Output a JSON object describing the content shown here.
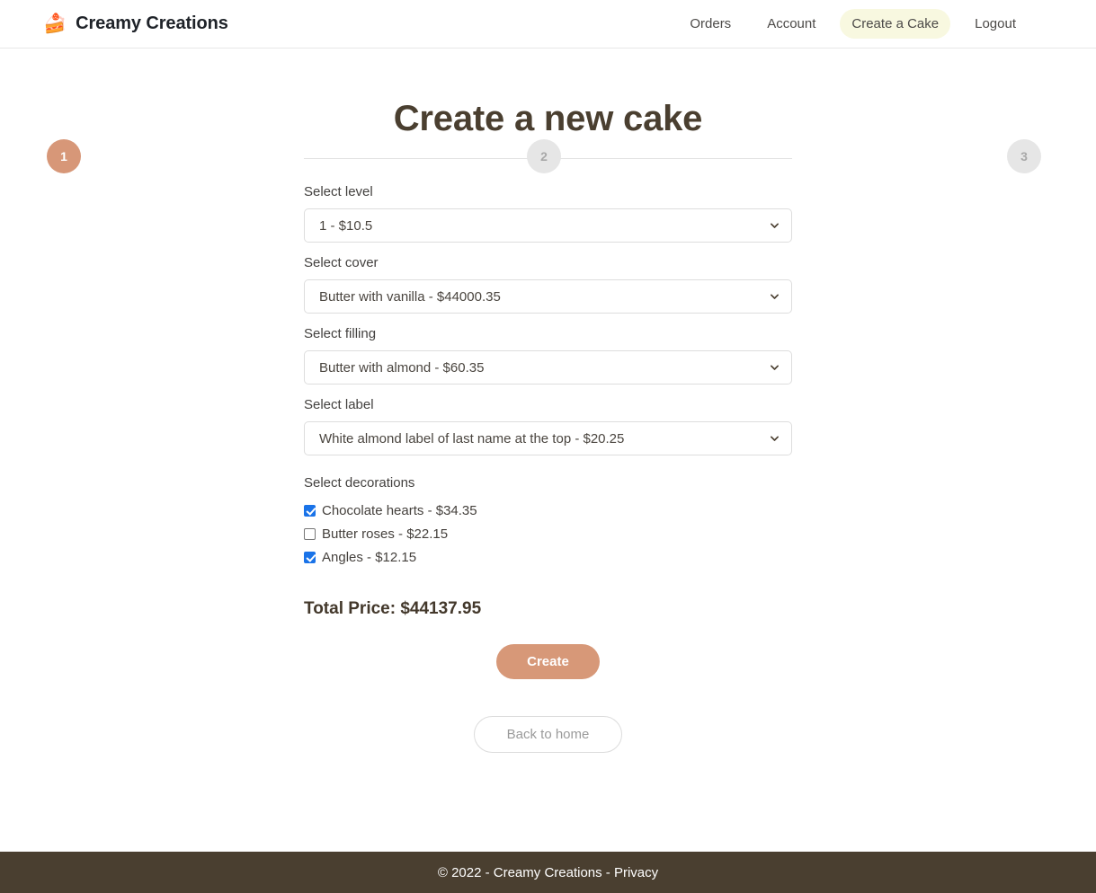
{
  "header": {
    "brand_icon": "cake-slice-icon",
    "brand_name": "Creamy Creations",
    "nav": [
      {
        "label": "Orders",
        "active": false
      },
      {
        "label": "Account",
        "active": false
      },
      {
        "label": "Create a Cake",
        "active": true
      },
      {
        "label": "Logout",
        "active": false
      }
    ]
  },
  "steps": [
    {
      "number": "1",
      "state": "active"
    },
    {
      "number": "2",
      "state": "inactive"
    },
    {
      "number": "3",
      "state": "inactive"
    }
  ],
  "main": {
    "title": "Create a new cake",
    "fields": [
      {
        "label": "Select level",
        "value": "1 - $10.5"
      },
      {
        "label": "Select cover",
        "value": "Butter with vanilla - $44000.35"
      },
      {
        "label": "Select filling",
        "value": "Butter with almond - $60.35"
      },
      {
        "label": "Select label",
        "value": "White almond label of last name at the top - $20.25"
      }
    ],
    "decorations_label": "Select decorations",
    "decorations": [
      {
        "label": "Chocolate hearts - $34.35",
        "checked": true
      },
      {
        "label": "Butter roses - $22.15",
        "checked": false
      },
      {
        "label": "Angles - $12.15",
        "checked": true
      }
    ],
    "total_price": "Total Price: $44137.95",
    "create_button": "Create",
    "back_button": "Back to home"
  },
  "footer": {
    "copyright": "© 2022 - Creamy Creations - ",
    "privacy_link": "Privacy"
  },
  "colors": {
    "accent": "#d79878",
    "title": "#4a3f30",
    "nav_pill": "#f8f8e0",
    "footer_bg": "#4a3f30",
    "checkbox": "#1a73e8",
    "step_inactive": "#e6e6e6"
  }
}
